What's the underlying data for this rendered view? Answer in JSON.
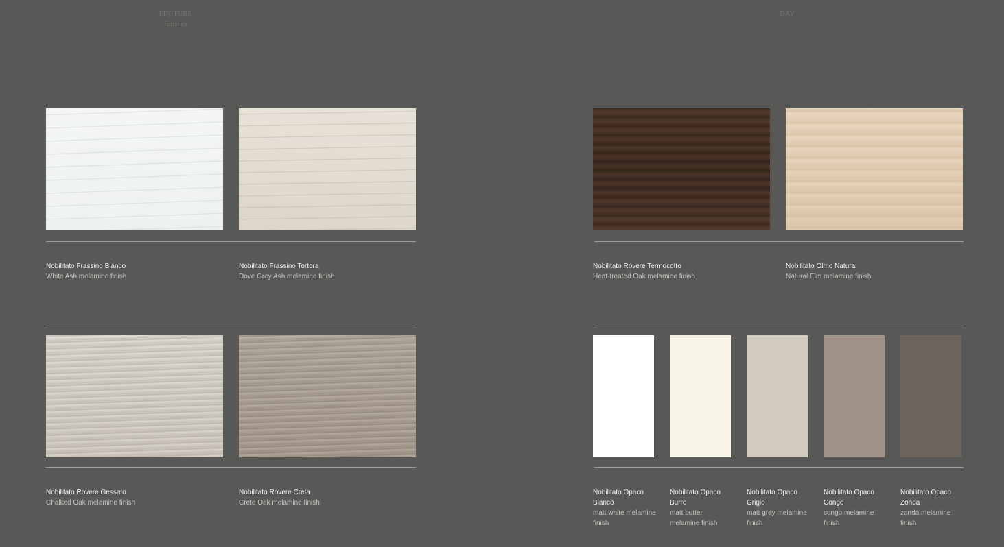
{
  "header": {
    "left_line1": "FINITURE",
    "left_line2": "finishes",
    "right": "DAY"
  },
  "finishes": [
    {
      "name": "Nobilitato Frassino Bianco",
      "desc": "White Ash melamine finish",
      "texture": "white-ash"
    },
    {
      "name": "Nobilitato Frassino Tortora",
      "desc": "Dove Grey Ash melamine finish",
      "texture": "dove-ash"
    },
    {
      "name": "Nobilitato Rovere Termocotto",
      "desc": "Heat-treated Oak melamine finish",
      "texture": "termocotto"
    },
    {
      "name": "Nobilitato Olmo Natura",
      "desc": "Natural Elm melamine finish",
      "texture": "olmo"
    },
    {
      "name": "Nobilitato Rovere Gessato",
      "desc": "Chalked Oak melamine finish",
      "texture": "gessato"
    },
    {
      "name": "Nobilitato Rovere Creta",
      "desc": "Crete Oak melamine finish",
      "texture": "creta"
    }
  ],
  "opaco": [
    {
      "name": "Nobilitato Opaco Bianco",
      "desc": "matt white melamine finish",
      "color": "#ffffff"
    },
    {
      "name": "Nobilitato Opaco Burro",
      "desc": "matt butter melamine finish",
      "color": "#f7f4e6"
    },
    {
      "name": "Nobilitato Opaco Grigio",
      "desc": "matt grey melamine finish",
      "color": "#d2cbbf"
    },
    {
      "name": "Nobilitato Opaco Congo",
      "desc": "congo melamine finish",
      "color": "#a09286"
    },
    {
      "name": "Nobilitato Opaco Zonda",
      "desc": "zonda melamine finish",
      "color": "#6e645e"
    }
  ],
  "colors": {
    "background": "#585856",
    "rule": "#9a9a97",
    "header_text": "#767673"
  }
}
